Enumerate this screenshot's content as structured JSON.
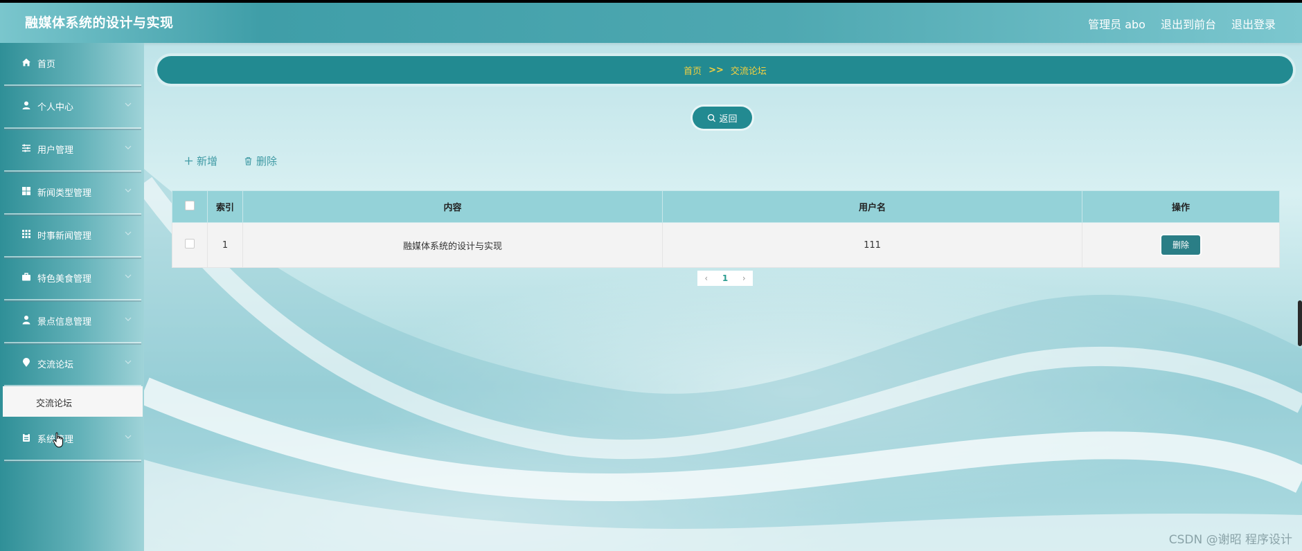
{
  "header": {
    "title": "融媒体系统的设计与实现",
    "user_label": "管理员 abo",
    "to_front_label": "退出到前台",
    "logout_label": "退出登录"
  },
  "sidebar": {
    "items": [
      {
        "label": "首页",
        "icon": "home-icon"
      },
      {
        "label": "个人中心",
        "icon": "user-icon"
      },
      {
        "label": "用户管理",
        "icon": "sliders-icon"
      },
      {
        "label": "新闻类型管理",
        "icon": "grid-icon"
      },
      {
        "label": "时事新闻管理",
        "icon": "apps-icon"
      },
      {
        "label": "特色美食管理",
        "icon": "briefcase-icon"
      },
      {
        "label": "景点信息管理",
        "icon": "person-icon"
      },
      {
        "label": "交流论坛",
        "icon": "pin-icon"
      },
      {
        "label": "系统管理",
        "icon": "clipboard-icon"
      }
    ],
    "submenu": {
      "label": "交流论坛"
    }
  },
  "breadcrumb": {
    "home": "首页",
    "separator": ">>",
    "current": "交流论坛"
  },
  "back_button": {
    "label": "返回"
  },
  "toolbar": {
    "add_label": "新增",
    "delete_label": "删除"
  },
  "table": {
    "columns": [
      "索引",
      "内容",
      "用户名",
      "操作"
    ],
    "rows": [
      {
        "index": "1",
        "content": "融媒体系统的设计与实现",
        "username": "111",
        "action": "删除"
      }
    ]
  },
  "pagination": {
    "current_page": "1"
  },
  "watermark": "CSDN @谢昭 程序设计",
  "colors": {
    "accent": "#228a91",
    "breadcrumb_text": "#f4d03f",
    "table_header": "#94d2d8"
  }
}
